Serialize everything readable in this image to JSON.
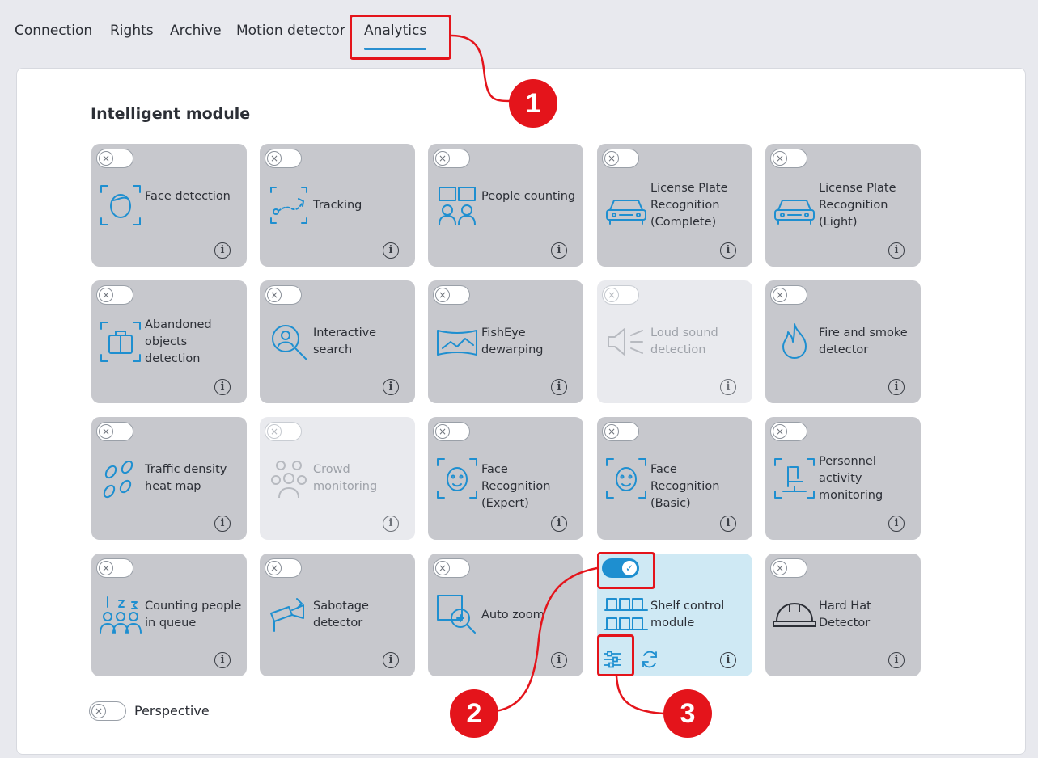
{
  "tabs": [
    "Connection",
    "Rights",
    "Archive",
    "Motion detector",
    "Analytics"
  ],
  "section_title": "Intelligent module",
  "modules": [
    {
      "label": "Face detection",
      "icon": "face-detection-icon",
      "state": "off"
    },
    {
      "label": "Tracking",
      "icon": "tracking-icon",
      "state": "off"
    },
    {
      "label": "People counting",
      "icon": "people-counting-icon",
      "state": "off"
    },
    {
      "label": "License Plate Recognition (Complete)",
      "icon": "car-icon",
      "state": "off"
    },
    {
      "label": "License Plate Recognition (Light)",
      "icon": "car-icon",
      "state": "off"
    },
    {
      "label": "Abandoned objects detection",
      "icon": "abandoned-object-icon",
      "state": "off"
    },
    {
      "label": "Interactive search",
      "icon": "interactive-search-icon",
      "state": "off"
    },
    {
      "label": "FishEye dewarping",
      "icon": "fisheye-icon",
      "state": "off"
    },
    {
      "label": "Loud sound detection",
      "icon": "loud-sound-icon",
      "state": "disabled"
    },
    {
      "label": "Fire and smoke detector",
      "icon": "fire-icon",
      "state": "off"
    },
    {
      "label": "Traffic density heat map",
      "icon": "footprints-icon",
      "state": "off"
    },
    {
      "label": "Crowd monitoring",
      "icon": "crowd-icon",
      "state": "disabled"
    },
    {
      "label": "Face Recognition (Expert)",
      "icon": "face-recognition-icon",
      "state": "off"
    },
    {
      "label": "Face Recognition (Basic)",
      "icon": "face-recognition-icon",
      "state": "off"
    },
    {
      "label": "Personnel activity monitoring",
      "icon": "office-chair-icon",
      "state": "off"
    },
    {
      "label": "Counting people in queue",
      "icon": "queue-icon",
      "state": "off"
    },
    {
      "label": "Sabotage detector",
      "icon": "camera-sabotage-icon",
      "state": "off"
    },
    {
      "label": "Auto zoom",
      "icon": "auto-zoom-icon",
      "state": "off"
    },
    {
      "label": "Shelf control module",
      "icon": "shelf-icon",
      "state": "on"
    },
    {
      "label": "Hard Hat Detector",
      "icon": "hard-hat-icon",
      "state": "off"
    }
  ],
  "perspective_label": "Perspective",
  "toggle_off_glyph": "×",
  "toggle_on_glyph": "✓",
  "info_glyph": "i",
  "callouts": [
    "1",
    "2",
    "3"
  ],
  "colors": {
    "accent": "#1e8fd0",
    "callout": "#e4141b",
    "card": "#c7c8cd",
    "card_active": "#cfe9f4"
  }
}
